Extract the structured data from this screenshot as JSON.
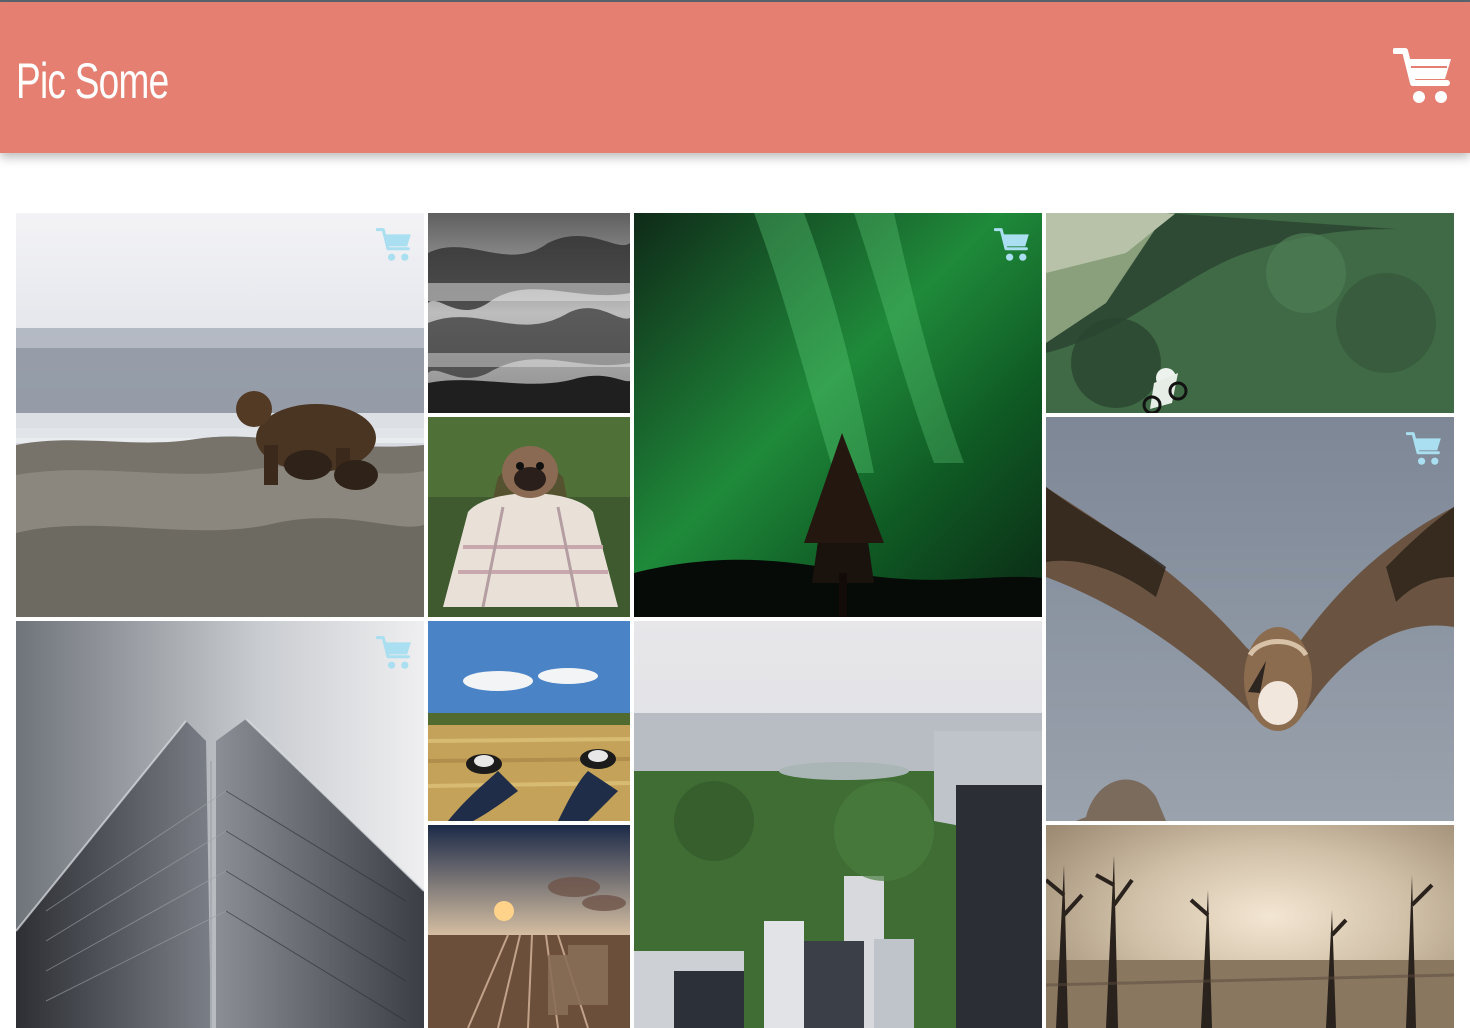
{
  "header": {
    "brand": "Pic Some",
    "cart_icon": "cart-icon",
    "background_color": "#e57f72"
  },
  "gallery": {
    "photos": [
      {
        "name": "grizzly-bear-with-cubs",
        "has_cart_icon": true
      },
      {
        "name": "misty-forest-black-white",
        "has_cart_icon": false
      },
      {
        "name": "northern-lights",
        "has_cart_icon": true
      },
      {
        "name": "mountain-biker-forest",
        "has_cart_icon": false
      },
      {
        "name": "pug-in-blanket",
        "has_cart_icon": false
      },
      {
        "name": "vulture-in-flight",
        "has_cart_icon": true
      },
      {
        "name": "skyscraper-looking-up",
        "has_cart_icon": true
      },
      {
        "name": "sneakers-in-field",
        "has_cart_icon": false
      },
      {
        "name": "central-park-aerial",
        "has_cart_icon": false
      },
      {
        "name": "sunset-rail-yard",
        "has_cart_icon": false
      },
      {
        "name": "dead-trees-fog",
        "has_cart_icon": false
      }
    ],
    "tile_cart_icon": "cart-icon",
    "tile_cart_color": "#a9dff0"
  }
}
